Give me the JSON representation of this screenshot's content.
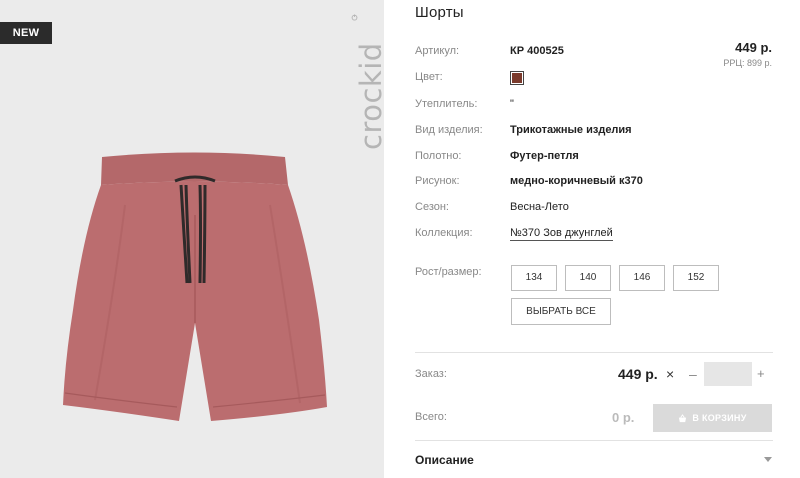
{
  "badge": "NEW",
  "brand": "crockid",
  "product": {
    "title": "Шорты",
    "price": "449 р.",
    "rrp": "РРЦ: 899 р.",
    "attributes": [
      {
        "label": "Артикул:",
        "value": "КР 400525",
        "bold": true
      },
      {
        "label": "Цвет:",
        "value": ""
      },
      {
        "label": "Утеплитель:",
        "value": "\""
      },
      {
        "label": "Вид изделия:",
        "value": "Трикотажные изделия",
        "bold": true
      },
      {
        "label": "Полотно:",
        "value": "Футер-петля",
        "bold": true
      },
      {
        "label": "Рисунок:",
        "value": "медно-коричневый к370",
        "bold": true
      },
      {
        "label": "Сезон:",
        "value": "Весна-Лето"
      },
      {
        "label": "Коллекция:",
        "value": "№370 Зов джунглей"
      }
    ],
    "swatch_color": "#7b3a2c"
  },
  "sizes": {
    "label": "Рост/размер:",
    "options": [
      "134",
      "140",
      "146",
      "152"
    ],
    "select_all": "ВЫБРАТЬ ВСЕ"
  },
  "order": {
    "label": "Заказ:",
    "price": "449 р.",
    "times": "×",
    "minus": "–",
    "plus": "+",
    "quantity": ""
  },
  "total": {
    "label": "Всего:",
    "value": "0 р.",
    "cart_button": "В КОРЗИНУ"
  },
  "description": {
    "label": "Описание"
  },
  "colors": {
    "shorts": "#b96a6c",
    "badge_bg": "#2b2b2b",
    "cart_bg": "#dadada"
  }
}
